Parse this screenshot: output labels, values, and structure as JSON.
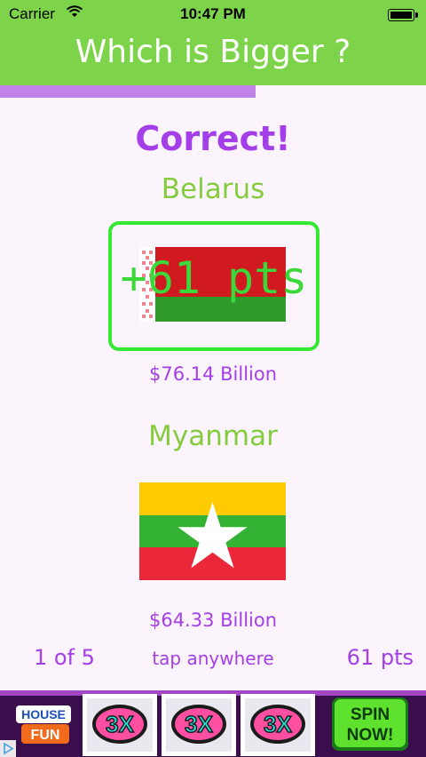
{
  "status": {
    "carrier": "Carrier",
    "time": "10:47 PM"
  },
  "nav": {
    "title": "Which is Bigger ?"
  },
  "progress": {
    "fraction": 0.6
  },
  "result": "Correct!",
  "country1": {
    "name": "Belarus",
    "value": "$76.14 Billion",
    "points": "+61 pts"
  },
  "country2": {
    "name": "Myanmar",
    "value": "$64.33 Billion"
  },
  "footer": {
    "question": "1 of 5",
    "hint": "tap anywhere",
    "score": "61 pts"
  },
  "ad": {
    "brand_top": "HOUSE",
    "brand_bottom": "FUN",
    "reel_label": "3X",
    "cta_top": "SPIN",
    "cta_bottom": "NOW!"
  },
  "colors": {
    "header": "#7dd44a",
    "accent": "#a33ee8",
    "country": "#84cc3e",
    "correct": "#33e933"
  }
}
